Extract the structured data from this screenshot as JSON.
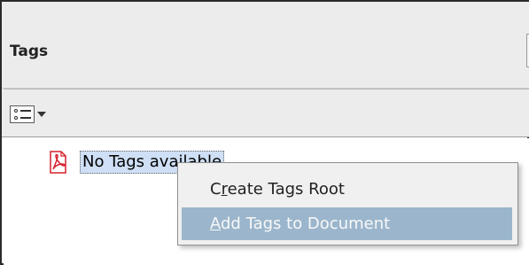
{
  "panel": {
    "title": "Tags"
  },
  "toolbar": {
    "options_icon": "tag-options-icon"
  },
  "tree": {
    "items": [
      {
        "icon": "pdf-icon",
        "label": "No Tags available"
      }
    ]
  },
  "context_menu": {
    "items": [
      {
        "label": "Create Tags Root",
        "accel_char": "r"
      },
      {
        "label": "Add Tags to Document",
        "accel_char": "A",
        "highlighted": true
      }
    ]
  },
  "colors": {
    "header_bg": "#ececec",
    "selection_bg": "#cfdff5",
    "menu_bg": "#f0f0f0",
    "menu_highlight": "#9bb6cc",
    "pdf_red": "#d6202b"
  }
}
